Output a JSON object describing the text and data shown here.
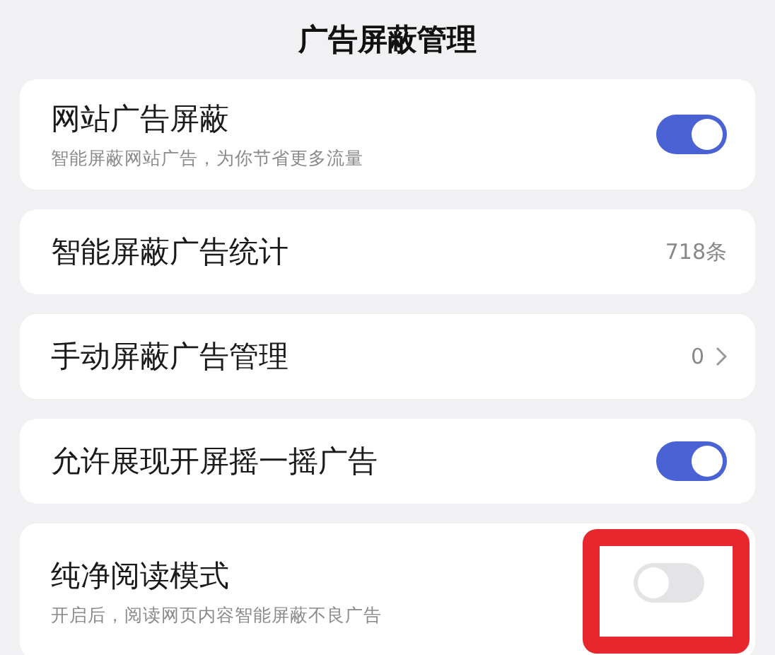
{
  "title": "广告屏蔽管理",
  "items": [
    {
      "kind": "toggle",
      "label": "网站广告屏蔽",
      "subtitle": "智能屏蔽网站广告，为你节省更多流量",
      "on": true,
      "highlighted": false
    },
    {
      "kind": "value",
      "label": "智能屏蔽广告统计",
      "value": "718条"
    },
    {
      "kind": "link",
      "label": "手动屏蔽广告管理",
      "value": "0"
    },
    {
      "kind": "toggle",
      "label": "允许展现开屏摇一摇广告",
      "on": true,
      "highlighted": false
    },
    {
      "kind": "toggle",
      "label": "纯净阅读模式",
      "subtitle": "开启后，阅读网页内容智能屏蔽不良广告",
      "on": false,
      "highlighted": true
    }
  ]
}
